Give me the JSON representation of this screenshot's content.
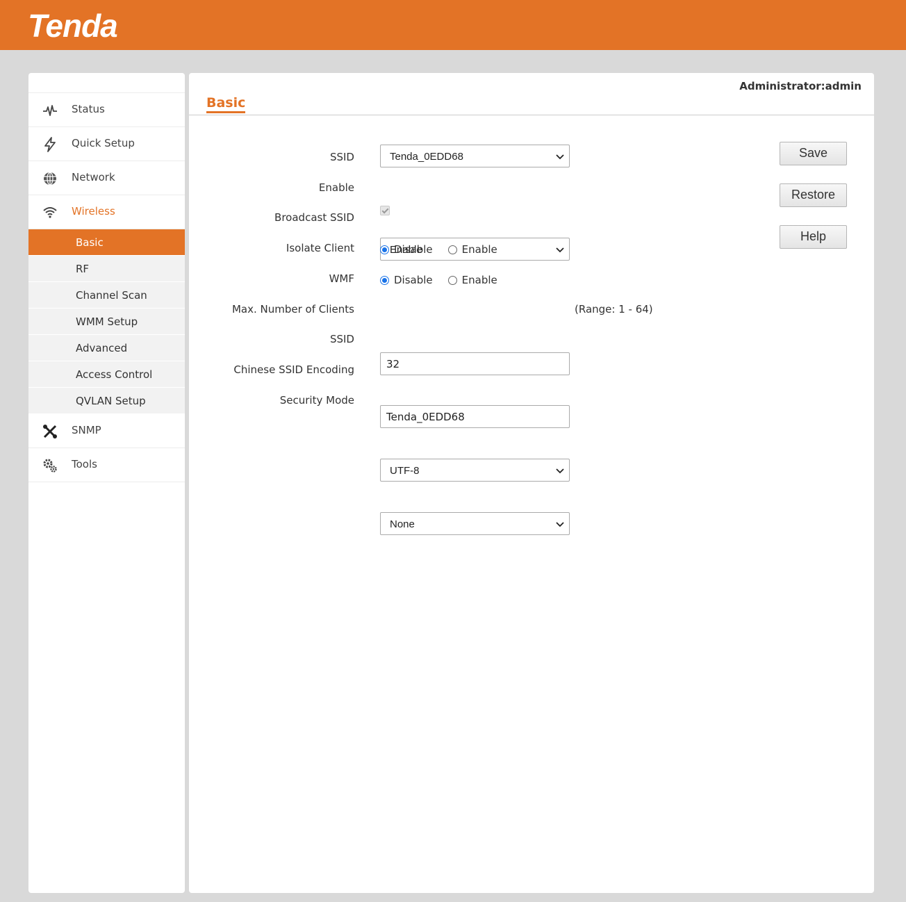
{
  "brand": {
    "logo": "Tenda",
    "accent_color": "#e37326"
  },
  "user": {
    "admin_label": "Administrator:admin"
  },
  "sidebar": {
    "items": [
      {
        "label": "Status",
        "icon": "pulse-icon"
      },
      {
        "label": "Quick Setup",
        "icon": "lightning-icon"
      },
      {
        "label": "Network",
        "icon": "globe-icon"
      },
      {
        "label": "Wireless",
        "icon": "wifi-icon",
        "active": true
      },
      {
        "label": "SNMP",
        "icon": "tools-icon"
      },
      {
        "label": "Tools",
        "icon": "gears-icon"
      }
    ],
    "wireless_sub": [
      {
        "label": "Basic",
        "selected": true
      },
      {
        "label": "RF"
      },
      {
        "label": "Channel Scan"
      },
      {
        "label": "WMM Setup"
      },
      {
        "label": "Advanced"
      },
      {
        "label": "Access Control"
      },
      {
        "label": "QVLAN Setup"
      }
    ]
  },
  "page": {
    "tab": "Basic"
  },
  "form": {
    "ssid_select": {
      "label": "SSID",
      "value": "Tenda_0EDD68"
    },
    "enable": {
      "label": "Enable",
      "checked": true
    },
    "broadcast_ssid": {
      "label": "Broadcast SSID",
      "value": "Enable"
    },
    "isolate_client": {
      "label": "Isolate Client",
      "opt1": "Disable",
      "opt2": "Enable",
      "selected": "Disable"
    },
    "wmf": {
      "label": "WMF",
      "opt1": "Disable",
      "opt2": "Enable",
      "selected": "Disable"
    },
    "max_clients": {
      "label": "Max. Number of Clients",
      "value": "32",
      "range": "(Range: 1 - 64)"
    },
    "ssid_text": {
      "label": "SSID",
      "value": "Tenda_0EDD68"
    },
    "chinese_encoding": {
      "label": "Chinese SSID Encoding",
      "value": "UTF-8"
    },
    "security_mode": {
      "label": "Security Mode",
      "value": "None"
    }
  },
  "buttons": {
    "save": "Save",
    "restore": "Restore",
    "help": "Help"
  }
}
